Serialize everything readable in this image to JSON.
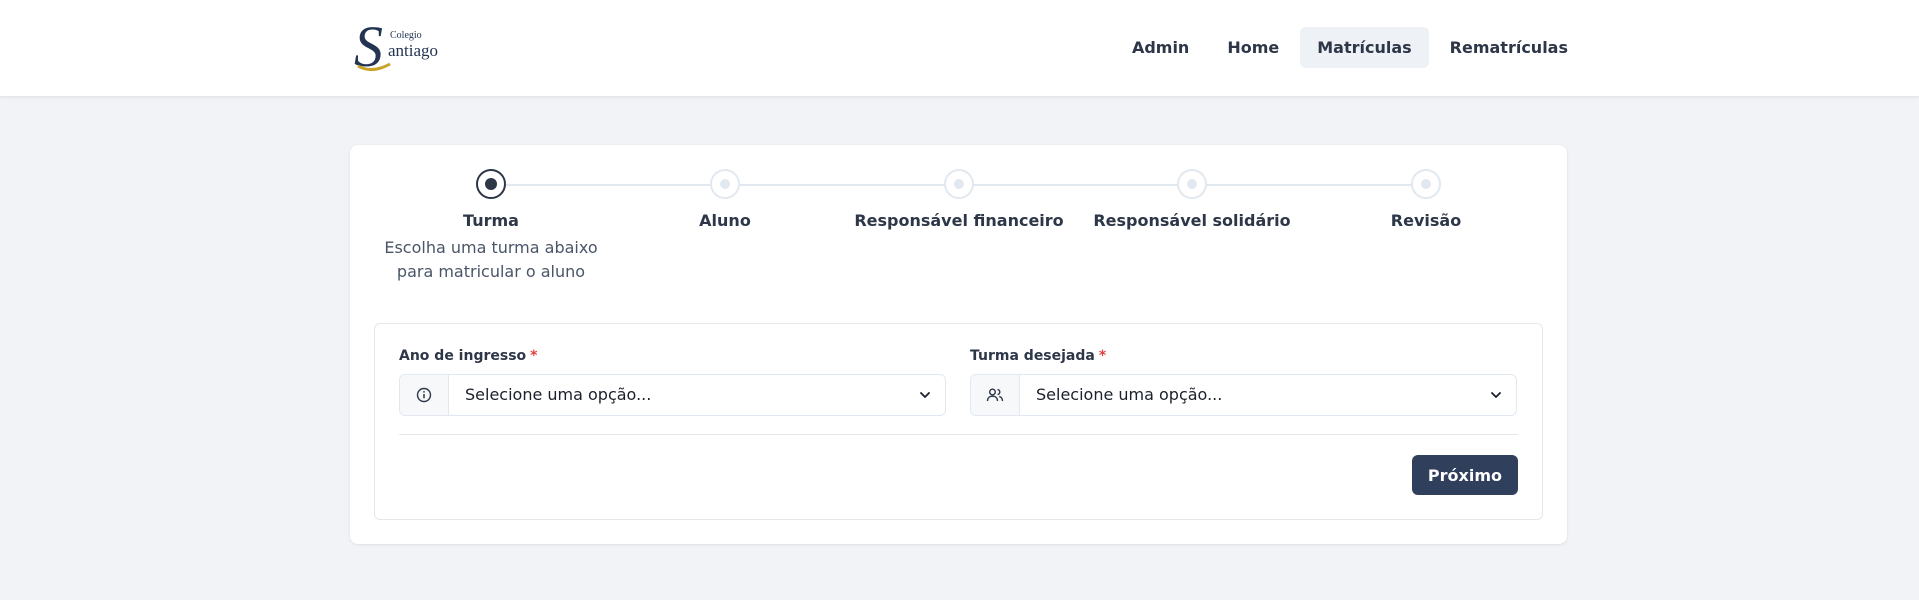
{
  "header": {
    "logo": {
      "small_text": "Colegio",
      "large_text": "antiago",
      "monogram": "S"
    },
    "nav": [
      {
        "label": "Admin",
        "active": false
      },
      {
        "label": "Home",
        "active": false
      },
      {
        "label": "Matrículas",
        "active": true
      },
      {
        "label": "Rematrículas",
        "active": false
      }
    ]
  },
  "stepper": {
    "steps": [
      {
        "title": "Turma",
        "description": "Escolha uma turma abaixo para matricular o aluno",
        "active": true
      },
      {
        "title": "Aluno",
        "description": "",
        "active": false
      },
      {
        "title": "Responsável financeiro",
        "description": "",
        "active": false
      },
      {
        "title": "Responsável solidário",
        "description": "",
        "active": false
      },
      {
        "title": "Revisão",
        "description": "",
        "active": false
      }
    ]
  },
  "form": {
    "fields": [
      {
        "label": "Ano de ingresso",
        "required_mark": "*",
        "value": "Selecione uma opção...",
        "icon": "info-circle-icon"
      },
      {
        "label": "Turma desejada",
        "required_mark": "*",
        "value": "Selecione uma opção...",
        "icon": "users-icon"
      }
    ],
    "next_label": "Próximo"
  },
  "colors": {
    "primary": "#2f3f5c",
    "required": "#e53e3e",
    "page_bg": "#f1f3f6"
  }
}
